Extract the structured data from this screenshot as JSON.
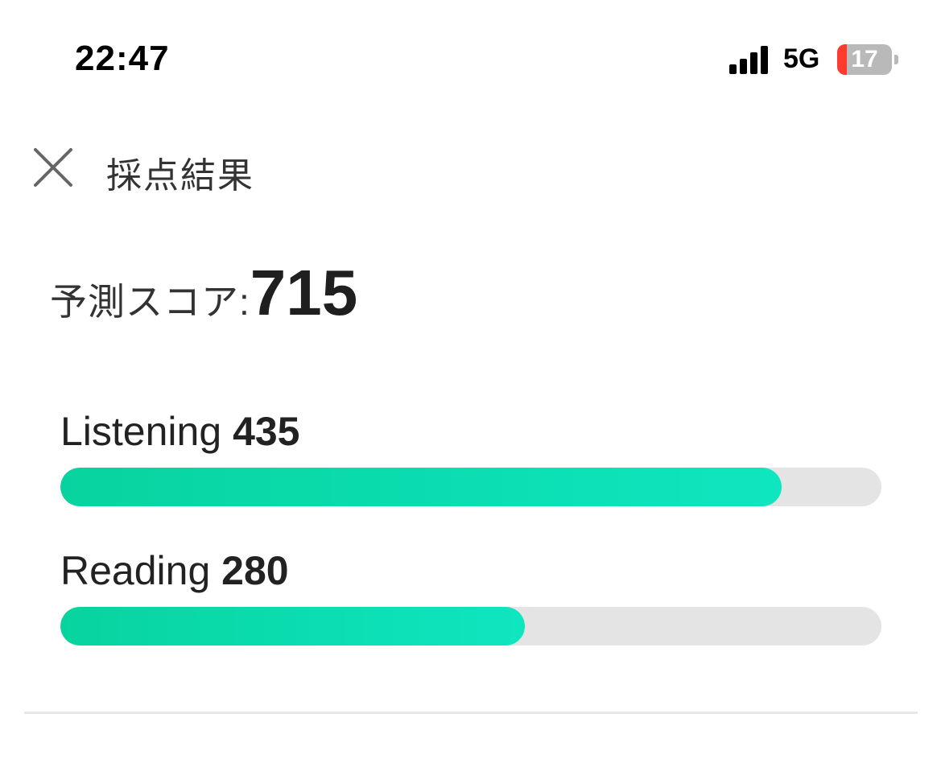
{
  "status_bar": {
    "time": "22:47",
    "network": "5G",
    "battery": "17",
    "battery_level": 0.17
  },
  "header": {
    "title": "採点結果",
    "close_icon": "close-icon"
  },
  "predicted_score": {
    "label": "予測スコア:",
    "value": "715"
  },
  "sections": [
    {
      "name": "Listening",
      "score": "435",
      "progress": 0.878
    },
    {
      "name": "Reading",
      "score": "280",
      "progress": 0.566
    }
  ],
  "colors": {
    "accent_start": "#08d39f",
    "accent_end": "#0ee6c0",
    "track": "#e4e4e4",
    "battery_low": "#ff3b30"
  }
}
